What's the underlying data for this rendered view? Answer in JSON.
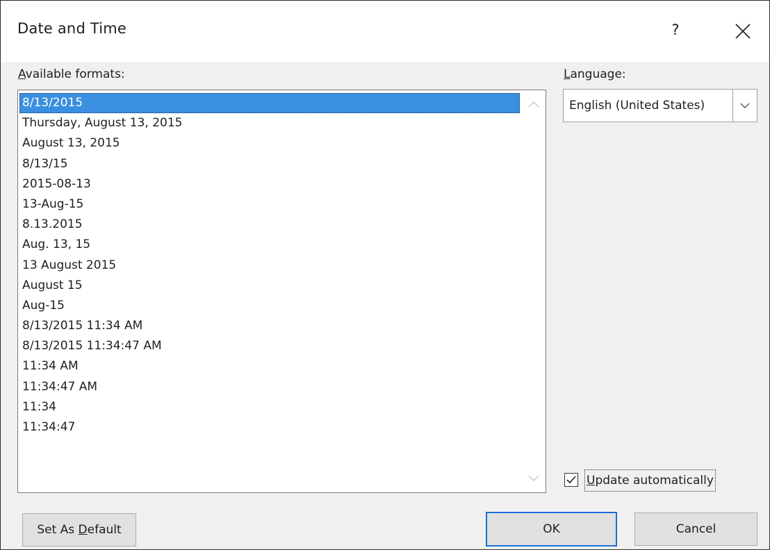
{
  "window": {
    "title": "Date and Time",
    "help_glyph": "?",
    "close_icon": "close-icon"
  },
  "formats": {
    "label_accel": "A",
    "label_rest": "vailable formats:",
    "selected_index": 0,
    "items": [
      "8/13/2015",
      "Thursday, August 13, 2015",
      "August 13, 2015",
      "8/13/15",
      "2015-08-13",
      "13-Aug-15",
      "8.13.2015",
      "Aug. 13, 15",
      "13 August 2015",
      "August 15",
      "Aug-15",
      "8/13/2015 11:34 AM",
      "8/13/2015 11:34:47 AM",
      "11:34 AM",
      "11:34:47 AM",
      "11:34",
      "11:34:47"
    ]
  },
  "language": {
    "label_accel": "L",
    "label_rest": "anguage:",
    "value": "English (United States)"
  },
  "update": {
    "checked": true,
    "label_accel": "U",
    "label_rest": "pdate automatically"
  },
  "buttons": {
    "default_pre": "Set As ",
    "default_accel": "D",
    "default_post": "efault",
    "ok": "OK",
    "cancel": "Cancel"
  },
  "colors": {
    "selection": "#3a8fe0",
    "ok_border": "#1a6fd6",
    "dialog_bg": "#f0f0f0"
  }
}
